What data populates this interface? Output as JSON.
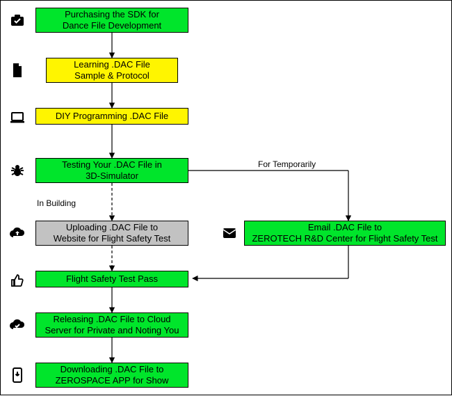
{
  "chart_data": {
    "type": "flowchart",
    "nodes": [
      {
        "id": "n1",
        "label": "Purchasing the SDK for\nDance File Development",
        "color": "green",
        "icon": "briefcase-check"
      },
      {
        "id": "n2",
        "label": "Learning .DAC File\nSample & Protocol",
        "color": "yellow",
        "icon": "file"
      },
      {
        "id": "n3",
        "label": "DIY Programming .DAC File",
        "color": "yellow",
        "icon": "laptop"
      },
      {
        "id": "n4",
        "label": "Testing Your .DAC File in\n3D-Simulator",
        "color": "green",
        "icon": "bug"
      },
      {
        "id": "n5",
        "label": "Uploading .DAC File to\nWebsite for Flight Safety Test",
        "color": "grey",
        "icon": "cloud-upload",
        "note": "In Building"
      },
      {
        "id": "n6",
        "label": "Email .DAC File to\nZEROTECH R&D Center for Flight Safety Test",
        "color": "green",
        "icon": "email",
        "note": "For Temporarily"
      },
      {
        "id": "n7",
        "label": "Flight Safety Test Pass",
        "color": "green",
        "icon": "thumbs-up"
      },
      {
        "id": "n8",
        "label": "Releasing .DAC File to Cloud\nServer for Private and Noting You",
        "color": "green",
        "icon": "cloud-check"
      },
      {
        "id": "n9",
        "label": "Downloading .DAC File to\nZEROSPACE APP for Show",
        "color": "green",
        "icon": "phone-download"
      }
    ],
    "edges": [
      {
        "from": "n1",
        "to": "n2",
        "style": "solid"
      },
      {
        "from": "n2",
        "to": "n3",
        "style": "solid"
      },
      {
        "from": "n3",
        "to": "n4",
        "style": "solid"
      },
      {
        "from": "n4",
        "to": "n5",
        "style": "dashed"
      },
      {
        "from": "n5",
        "to": "n7",
        "style": "dashed"
      },
      {
        "from": "n4",
        "to": "n6",
        "style": "solid",
        "label": "For Temporarily"
      },
      {
        "from": "n6",
        "to": "n7",
        "style": "solid"
      },
      {
        "from": "n7",
        "to": "n8",
        "style": "solid"
      },
      {
        "from": "n8",
        "to": "n9",
        "style": "solid"
      }
    ]
  },
  "nodes": {
    "n1": "Purchasing the SDK for\nDance File Development",
    "n2": "Learning .DAC File\nSample & Protocol",
    "n3": "DIY Programming .DAC File",
    "n4": "Testing Your .DAC File in\n3D-Simulator",
    "n5": "Uploading .DAC File to\nWebsite for Flight Safety Test",
    "n6": "Email .DAC File to\nZEROTECH R&D Center for Flight Safety Test",
    "n7": "Flight Safety Test Pass",
    "n8": "Releasing .DAC File to Cloud\nServer for Private and Noting You",
    "n9": "Downloading .DAC File to\nZEROSPACE APP for Show"
  },
  "labels": {
    "in_building": "In Building",
    "for_temporarily": "For Temporarily"
  }
}
